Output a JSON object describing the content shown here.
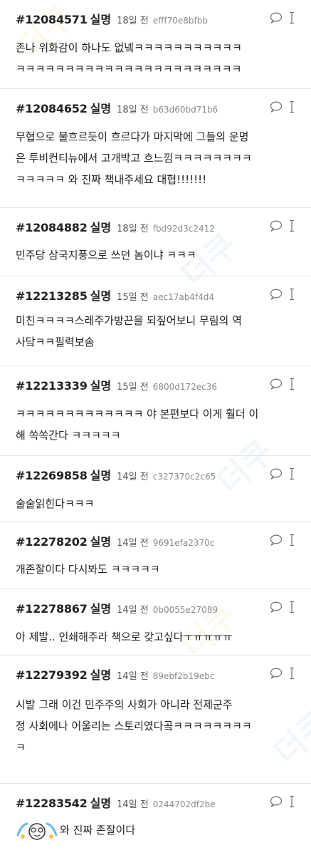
{
  "watermark": "더쿠",
  "comments": [
    {
      "num": "#12084571",
      "anon": "실명",
      "time": "18일 전",
      "hash": "efff70e8bfbb",
      "lines": [
        "존나 위화감이 하나도 없넼ㅋㅋㅋㅋㅋㅋㅋㅋㅋㅋㅋ",
        "ㅋㅋㅋㅋㅋㅋㅋㅋㅋㅋㅋㅋㅋㅋㅋㅋㅋㅋㅋㅋㅋㅋㅋ"
      ]
    },
    {
      "num": "#12084652",
      "anon": "실명",
      "time": "18일 전",
      "hash": "b63d60bd71b6",
      "lines": [
        "무협으로 물흐르듯이 흐르다가 마지막에 그들의 운명",
        "은 투비컨티뉴에서 고개박고 흐느낌ㅋㅋㅋㅋㅋㅋㅋㅋ",
        "ㅋㅋㅋㅋㅋ 와 진짜 책내주세요 대협!!!!!!!"
      ]
    },
    {
      "num": "#12084882",
      "anon": "실명",
      "time": "18일 전",
      "hash": "fbd92d3c2412",
      "lines": [
        "민주당 삼국지풍으로 쓰던 놈이냐 ㅋㅋㅋ"
      ]
    },
    {
      "num": "#12213285",
      "anon": "실명",
      "time": "15일 전",
      "hash": "aec17ab4f4d4",
      "lines": [
        "미친ㅋㅋㅋㅋ스레주가방끈을 되짚어보니 무림의 역",
        "사닼ㅋㅋ필력보솜"
      ]
    },
    {
      "num": "#12213339",
      "anon": "실명",
      "time": "15일 전",
      "hash": "6800d172ec36",
      "lines": [
        "ㅋㅋㅋㅋㅋㅋㅋㅋㅋㅋㅋㅋㅋ 야 본편보다 이게 훨더 이",
        "해 쏙쏙간다 ㅋㅋㅋㅋㅋ"
      ]
    },
    {
      "num": "#12269858",
      "anon": "실명",
      "time": "14일 전",
      "hash": "c327370c2c65",
      "lines": [
        "술술읽힌다ㅋㅋㅋ"
      ]
    },
    {
      "num": "#12278202",
      "anon": "실명",
      "time": "14일 전",
      "hash": "9691efa2370c",
      "lines": [
        "개존잘이다 다시봐도 ㅋㅋㅋㅋㅋ"
      ]
    },
    {
      "num": "#12278867",
      "anon": "실명",
      "time": "14일 전",
      "hash": "0b0055e27089",
      "lines": [
        "아 제발.. 인쇄해주라 책으로 갖고싶다ㅜㅠㅠㅠㅠ"
      ]
    },
    {
      "num": "#12279392",
      "anon": "실명",
      "time": "14일 전",
      "hash": "89ebf2b19ebc",
      "lines": [
        "시발 그래 이건 민주주의 사회가 아니라 전제군주",
        "정 사회에나 어울리는 스토리였다곸ㅋㅋㅋㅋㅋㅋㅋㅋ",
        "ㅋ"
      ]
    },
    {
      "num": "#12283542",
      "anon": "실명",
      "time": "14일 전",
      "hash": "0244702df2be",
      "lines": [
        "와 진짜 존잘이다"
      ]
    }
  ],
  "colors": {
    "divider": "#e4e4e4",
    "text": "#222222",
    "meta": "#8a8a8a"
  },
  "icons": [
    "comment-reply-icon",
    "text-cursor-icon"
  ]
}
